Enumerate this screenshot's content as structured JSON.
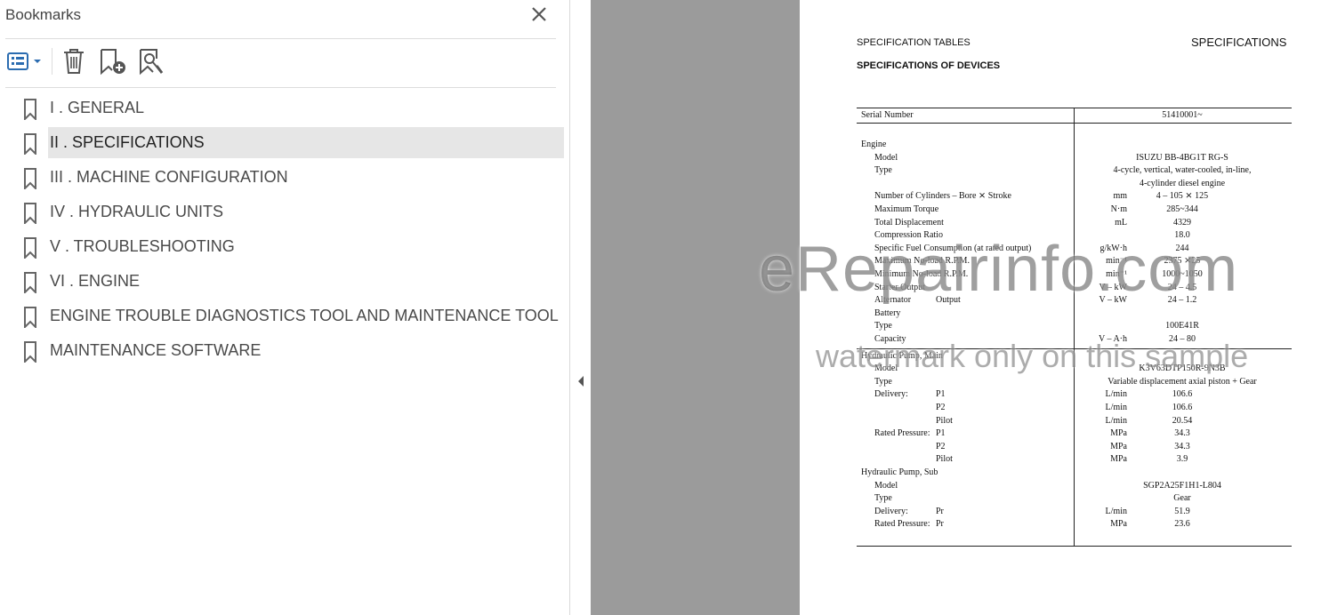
{
  "panel": {
    "title": "Bookmarks",
    "toolbar": {
      "options_icon": "bookmark-options-icon",
      "delete_icon": "trash-icon",
      "new_icon": "new-bookmark-icon",
      "expand_icon": "find-current-bookmark-icon"
    },
    "items": [
      {
        "label": "I . GENERAL",
        "selected": false
      },
      {
        "label": "II . SPECIFICATIONS",
        "selected": true
      },
      {
        "label": "III . MACHINE CONFIGURATION",
        "selected": false
      },
      {
        "label": "IV . HYDRAULIC UNITS",
        "selected": false
      },
      {
        "label": "V . TROUBLESHOOTING",
        "selected": false
      },
      {
        "label": "VI . ENGINE",
        "selected": false
      },
      {
        "label": "ENGINE TROUBLE DIAGNOSTICS TOOL AND MAINTENANCE TOOL",
        "selected": false
      },
      {
        "label": "MAINTENANCE SOFTWARE",
        "selected": false
      }
    ]
  },
  "document": {
    "header_left": "SPECIFICATION TABLES",
    "header_right": "SPECIFICATIONS",
    "subtitle": "SPECIFICATIONS OF DEVICES",
    "serial_label": "Serial Number",
    "serial_value": "51410001~",
    "rows": [
      {
        "l1": "Engine",
        "l2": "",
        "l3": "",
        "unit": "",
        "val": ""
      },
      {
        "l1": "",
        "l2": "Model",
        "l3": "",
        "unit": "",
        "val": "ISUZU BB-4BG1T RG-S"
      },
      {
        "l1": "",
        "l2": "Type",
        "l3": "",
        "unit": "",
        "val": "4-cycle, vertical, water-cooled, in-line,"
      },
      {
        "l1": "",
        "l2": "",
        "l3": "",
        "unit": "",
        "val": "4-cylinder diesel engine"
      },
      {
        "l1": "",
        "l2": "Number of Cylinders – Bore ⨯ Stroke",
        "l3": "",
        "unit": "mm",
        "val": "4 – 105 ⨯ 125"
      },
      {
        "l1": "",
        "l2": "Maximum Torque",
        "l3": "",
        "unit": "N·m",
        "val": "285~344"
      },
      {
        "l1": "",
        "l2": "Total Displacement",
        "l3": "",
        "unit": "mL",
        "val": "4329"
      },
      {
        "l1": "",
        "l2": "Compression Ratio",
        "l3": "",
        "unit": "",
        "val": "18.0"
      },
      {
        "l1": "",
        "l2": "Specific Fuel Consumption (at rated output)",
        "l3": "",
        "unit": "g/kW·h",
        "val": "244"
      },
      {
        "l1": "",
        "l2": "Maximum No-load R.P.M.",
        "l3": "",
        "unit": "min⁻¹",
        "val": "2375 ⨯25"
      },
      {
        "l1": "",
        "l2": "Minimum No-load R.P.M.",
        "l3": "",
        "unit": "min⁻¹",
        "val": "1000~1050"
      },
      {
        "l1": "",
        "l2": "Starter    Output",
        "l3": "",
        "unit": "V – kW",
        "val": "24 – 4.5"
      },
      {
        "l1": "",
        "l2": "Alternator",
        "l3": "Output",
        "unit": "V – kW",
        "val": "24 – 1.2"
      },
      {
        "l1": "",
        "l2": "Battery",
        "l3": "",
        "unit": "",
        "val": ""
      },
      {
        "l1": "",
        "l2": "    Type",
        "l3": "",
        "unit": "",
        "val": "100E41R"
      },
      {
        "l1": "",
        "l2": "    Capacity",
        "l3": "",
        "unit": "V – A·h",
        "val": "24 – 80"
      },
      {
        "l1": "Hydraulic Pump, Main",
        "l2": "",
        "l3": "",
        "unit": "",
        "val": ""
      },
      {
        "l1": "",
        "l2": "Model",
        "l3": "",
        "unit": "",
        "val": "K3V63DTP150R-9N3B"
      },
      {
        "l1": "",
        "l2": "Type",
        "l3": "",
        "unit": "",
        "val": "Variable displacement axial piston + Gear"
      },
      {
        "l1": "",
        "l2": "Delivery:",
        "l3": "P1",
        "unit": "L/min",
        "val": "106.6"
      },
      {
        "l1": "",
        "l2": "",
        "l3": "P2",
        "unit": "L/min",
        "val": "106.6"
      },
      {
        "l1": "",
        "l2": "",
        "l3": "Pilot",
        "unit": "L/min",
        "val": "20.54"
      },
      {
        "l1": "",
        "l2": "Rated Pressure:",
        "l3": "P1",
        "unit": "MPa",
        "val": "34.3"
      },
      {
        "l1": "",
        "l2": "",
        "l3": "P2",
        "unit": "MPa",
        "val": "34.3"
      },
      {
        "l1": "",
        "l2": "",
        "l3": "Pilot",
        "unit": "MPa",
        "val": "3.9"
      },
      {
        "l1": "Hydraulic Pump, Sub",
        "l2": "",
        "l3": "",
        "unit": "",
        "val": ""
      },
      {
        "l1": "",
        "l2": "Model",
        "l3": "",
        "unit": "",
        "val": "SGP2A25F1H1-L804"
      },
      {
        "l1": "",
        "l2": "Type",
        "l3": "",
        "unit": "",
        "val": "Gear"
      },
      {
        "l1": "",
        "l2": "Delivery:",
        "l3": "Pr",
        "unit": "L/min",
        "val": "51.9"
      },
      {
        "l1": "",
        "l2": "Rated Pressure:",
        "l3": "Pr",
        "unit": "MPa",
        "val": "23.6"
      }
    ]
  },
  "watermark": {
    "line1": "eRepairinfo.com",
    "line2": "watermark only on this sample"
  }
}
